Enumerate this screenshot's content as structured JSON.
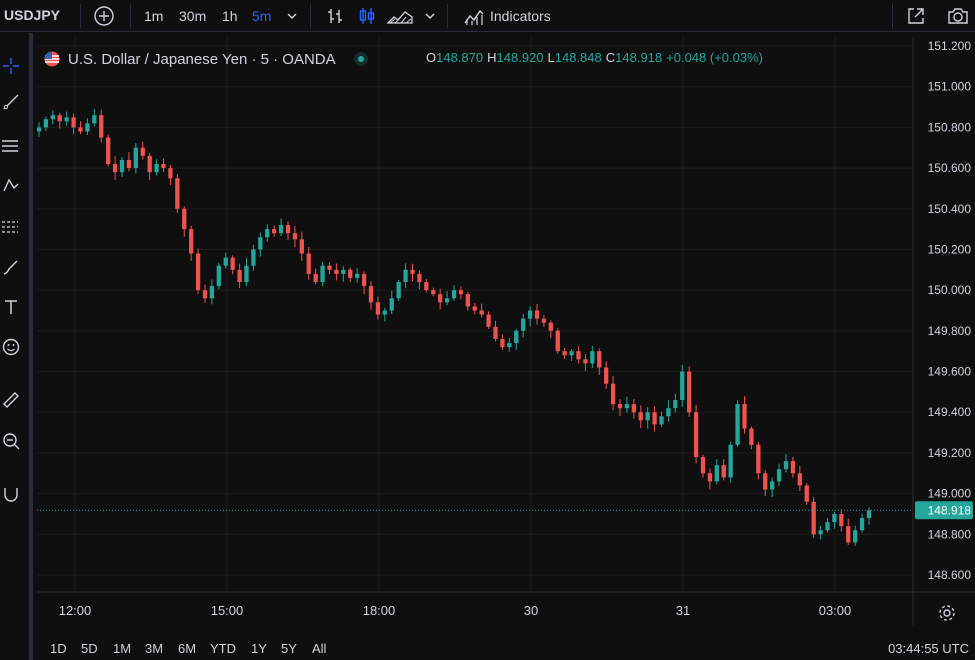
{
  "toolbar": {
    "symbol": "USDJPY",
    "intervals": [
      "1m",
      "30m",
      "1h",
      "5m"
    ],
    "indicators_label": "Indicators",
    "colors": {
      "active": "#2962ff",
      "text": "#d1d4dc"
    }
  },
  "legend": {
    "title": "U.S. Dollar / Japanese Yen · 5 · OANDA",
    "open_label": "O",
    "open": "148.870",
    "high_label": "H",
    "high": "148.920",
    "low_label": "L",
    "low": "148.848",
    "close_label": "C",
    "close": "148.918",
    "change": "+0.048 (+0.03%)"
  },
  "timeframes": [
    "1D",
    "5D",
    "1M",
    "3M",
    "6M",
    "YTD",
    "1Y",
    "5Y",
    "All"
  ],
  "clock": "03:44:55 UTC",
  "chart_data": {
    "type": "candlestick",
    "price_axis_ticks": [
      "151.200",
      "151.000",
      "150.800",
      "150.600",
      "150.400",
      "150.200",
      "150.000",
      "149.800",
      "149.600",
      "149.400",
      "149.200",
      "149.000",
      "148.800",
      "148.600"
    ],
    "ylim": [
      148.5,
      151.25
    ],
    "time_axis_ticks": [
      "12:00",
      "15:00",
      "18:00",
      "30",
      "31",
      "03:00"
    ],
    "last_price": "148.918",
    "up_color": "#26a69a",
    "down_color": "#ef5350",
    "closes": [
      150.8,
      150.84,
      150.86,
      150.83,
      150.85,
      150.8,
      150.78,
      150.82,
      150.86,
      150.75,
      150.62,
      150.58,
      150.64,
      150.6,
      150.7,
      150.66,
      150.58,
      150.62,
      150.6,
      150.55,
      150.4,
      150.3,
      150.18,
      150.0,
      149.96,
      150.02,
      150.12,
      150.16,
      150.1,
      150.04,
      150.12,
      150.2,
      150.26,
      150.3,
      150.28,
      150.32,
      150.28,
      150.25,
      150.18,
      150.08,
      150.04,
      150.12,
      150.1,
      150.08,
      150.1,
      150.06,
      150.08,
      150.02,
      149.94,
      149.88,
      149.9,
      149.96,
      150.04,
      150.1,
      150.08,
      150.04,
      150.0,
      149.98,
      149.94,
      149.96,
      150.0,
      149.98,
      149.92,
      149.9,
      149.88,
      149.82,
      149.76,
      149.72,
      149.74,
      149.8,
      149.86,
      149.9,
      149.86,
      149.84,
      149.8,
      149.7,
      149.68,
      149.7,
      149.66,
      149.64,
      149.7,
      149.62,
      149.54,
      149.44,
      149.42,
      149.44,
      149.4,
      149.36,
      149.4,
      149.34,
      149.38,
      149.42,
      149.46,
      149.6,
      149.4,
      149.18,
      149.1,
      149.06,
      149.14,
      149.08,
      149.24,
      149.44,
      149.32,
      149.24,
      149.1,
      149.02,
      149.06,
      149.12,
      149.16,
      149.1,
      149.04,
      148.96,
      148.8,
      148.82,
      148.86,
      148.9,
      148.84,
      148.76,
      148.82,
      148.88,
      148.918
    ]
  }
}
